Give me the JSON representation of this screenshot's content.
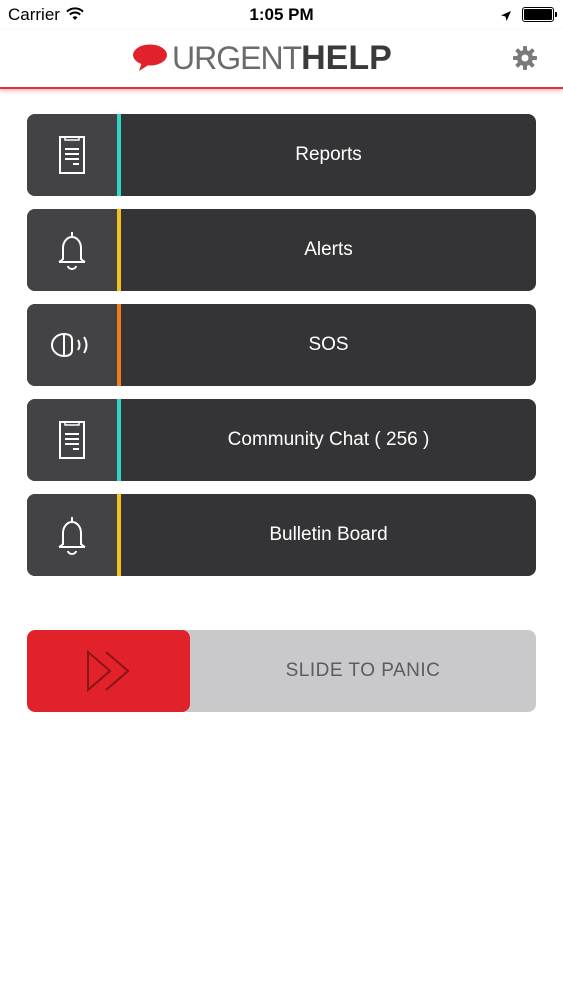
{
  "status_bar": {
    "carrier": "Carrier",
    "time": "1:05 PM",
    "wifi_icon": "wifi-icon",
    "location_icon": "location-arrow-icon",
    "battery_icon": "battery-icon"
  },
  "header": {
    "logo_text_light": "URGENT",
    "logo_text_bold": "HELP",
    "logo_icon": "speech-bubble-icon",
    "settings_icon": "gear-icon",
    "accent_color": "#e6303a"
  },
  "menu": {
    "items": [
      {
        "label": "Reports",
        "icon": "document-icon",
        "accent": "#2fd6c4"
      },
      {
        "label": "Alerts",
        "icon": "bell-icon",
        "accent": "#f4c21b"
      },
      {
        "label": "SOS",
        "icon": "sos-broadcast-icon",
        "accent": "#f07c1c"
      },
      {
        "label": "Community Chat ( 256 )",
        "icon": "document-icon",
        "accent": "#2fd6c4"
      },
      {
        "label": "Bulletin Board",
        "icon": "bell-icon",
        "accent": "#f4c21b"
      }
    ]
  },
  "panic_slider": {
    "label": "SLIDE TO PANIC",
    "handle_icon": "fast-forward-icon",
    "handle_color": "#e2222a"
  }
}
